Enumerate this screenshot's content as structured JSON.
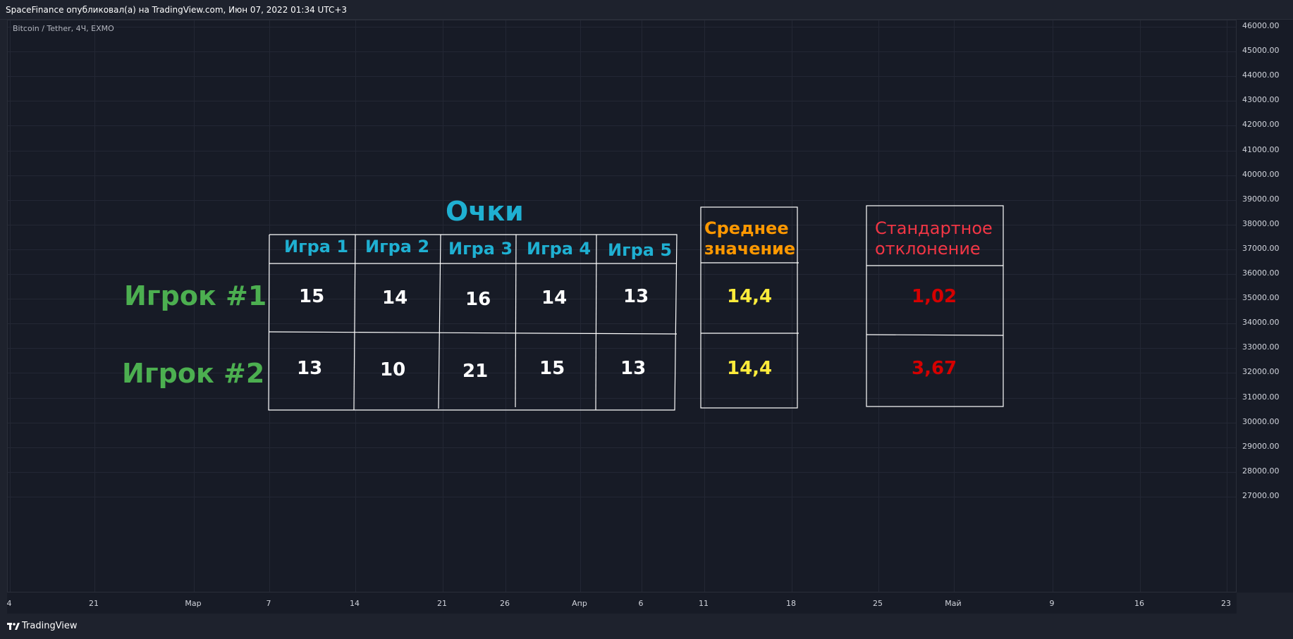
{
  "header": {
    "publish_info": "SpaceFinance опубликовал(а) на TradingView.com, Июн 07, 2022 01:34 UTC+3"
  },
  "chart": {
    "symbol_label": "Bitcoin / Tether, 4Ч, EXMO",
    "price_ticks": [
      "46000.00",
      "45000.00",
      "44000.00",
      "43000.00",
      "42000.00",
      "41000.00",
      "40000.00",
      "39000.00",
      "38000.00",
      "37000.00",
      "36000.00",
      "35000.00",
      "34000.00",
      "33000.00",
      "32000.00",
      "31000.00",
      "30000.00",
      "29000.00",
      "28000.00",
      "27000.00"
    ],
    "time_ticks": [
      "4",
      "21",
      "Мар",
      "7",
      "14",
      "21",
      "26",
      "Апр",
      "6",
      "11",
      "18",
      "25",
      "Май",
      "9",
      "16",
      "23"
    ]
  },
  "drawing": {
    "title": "Очки",
    "games": [
      "Игра 1",
      "Игра 2",
      "Игра 3",
      "Игра 4",
      "Игра 5"
    ],
    "players": [
      {
        "name": "Игрок #1",
        "scores": [
          "15",
          "14",
          "16",
          "14",
          "13"
        ],
        "mean": "14,4",
        "sd": "1,02"
      },
      {
        "name": "Игрок #2",
        "scores": [
          "13",
          "10",
          "21",
          "15",
          "13"
        ],
        "mean": "14,4",
        "sd": "3,67"
      }
    ],
    "mean_header_line1": "Среднее",
    "mean_header_line2": "значение",
    "sd_header_line1": "Стандартное",
    "sd_header_line2": "отклонение"
  },
  "footer": {
    "brand": "TradingView"
  },
  "colors": {
    "background": "#171b26",
    "title": "#1fb0d2",
    "player": "#4caf50",
    "mean_header": "#ff9800",
    "mean_value": "#ffeb3b",
    "sd_header": "#f23645",
    "sd_value": "#d50000"
  }
}
